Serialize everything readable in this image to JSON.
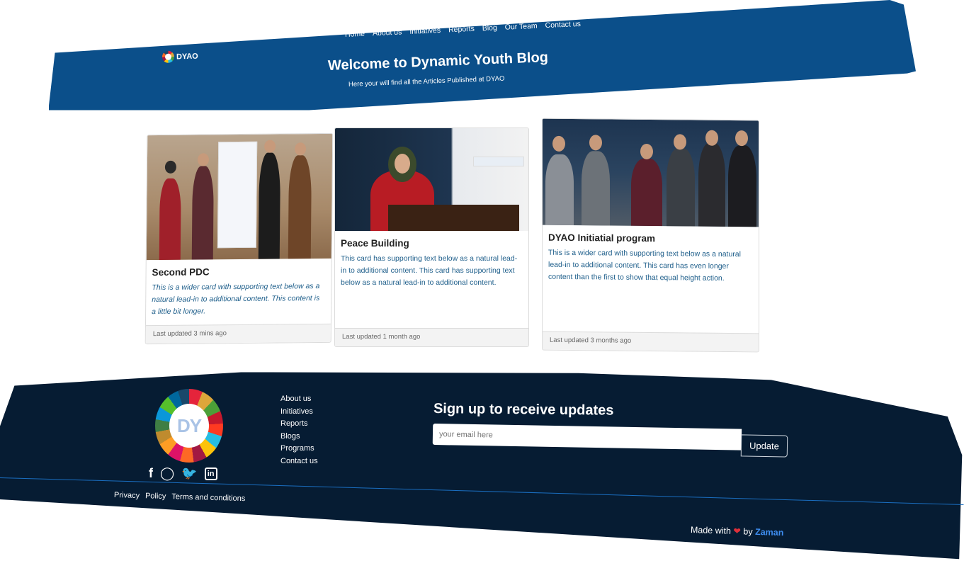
{
  "header": {
    "brand": "DYAO",
    "nav": [
      "Home",
      "About us",
      "Initiatives",
      "Reports",
      "Blog",
      "Our Team",
      "Contact us"
    ],
    "title": "Welcome to Dynamic Youth Blog",
    "subtitle": "Here your will find all the Articles Published at DYAO",
    "color": "#0b4f8a"
  },
  "cards": [
    {
      "title": "Second PDC",
      "text": "This is a wider card with supporting text below as a natural lead-in to additional content. This content is a little bit longer.",
      "footer": "Last updated 3 mins ago"
    },
    {
      "title": "Peace Building",
      "text": "This card has supporting text below as a natural lead-in to additional content. This card has supporting text below as a natural lead-in to additional content.",
      "footer": "Last updated 1 month ago"
    },
    {
      "title": "DYAO Initiatial program",
      "text": "This is a wider card with supporting text below as a natural lead-in to additional content. This card has even longer content than the first to show that equal height action.",
      "footer": "Last updated 3 months ago"
    }
  ],
  "footer": {
    "logo_text": "DY",
    "links": [
      "About us",
      "Initiatives",
      "Reports",
      "Blogs",
      "Programs",
      "Contact us"
    ],
    "signup_title": "Sign up to receive updates",
    "email_placeholder": "your email here",
    "update_label": "Update",
    "legal": [
      "Privacy",
      "Policy",
      "Terms and conditions"
    ],
    "made_with": "Made with",
    "by": "by",
    "author": "Zaman",
    "color": "#061c33",
    "social_icons": [
      "facebook-icon",
      "instagram-icon",
      "twitter-icon",
      "linkedin-icon"
    ]
  }
}
